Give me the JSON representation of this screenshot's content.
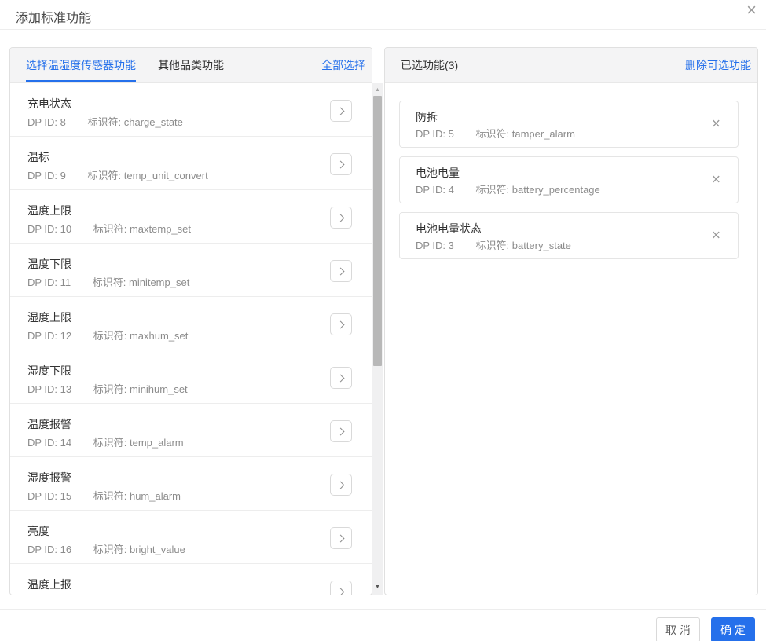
{
  "dialog": {
    "title": "添加标准功能"
  },
  "colors": {
    "accent": "#2570eb",
    "header_bg": "#f4f4f5",
    "panel_border": "#e0e0e0",
    "meta_text": "#8c8c8c"
  },
  "icons": {
    "close": "×",
    "remove": "×",
    "chevron_right": ">",
    "scroll_up": "▲",
    "scroll_down": "▼"
  },
  "left_panel": {
    "tabs": [
      {
        "label": "选择温湿度传感器功能",
        "active": true
      },
      {
        "label": "其他品类功能",
        "active": false
      }
    ],
    "select_all_label": "全部选择",
    "items": [
      {
        "name": "充电状态",
        "dp": "DP ID: 8",
        "identifier": "标识符: charge_state"
      },
      {
        "name": "温标",
        "dp": "DP ID: 9",
        "identifier": "标识符: temp_unit_convert"
      },
      {
        "name": "温度上限",
        "dp": "DP ID: 10",
        "identifier": "标识符: maxtemp_set"
      },
      {
        "name": "温度下限",
        "dp": "DP ID: 11",
        "identifier": "标识符: minitemp_set"
      },
      {
        "name": "湿度上限",
        "dp": "DP ID: 12",
        "identifier": "标识符: maxhum_set"
      },
      {
        "name": "湿度下限",
        "dp": "DP ID: 13",
        "identifier": "标识符: minihum_set"
      },
      {
        "name": "温度报警",
        "dp": "DP ID: 14",
        "identifier": "标识符: temp_alarm"
      },
      {
        "name": "湿度报警",
        "dp": "DP ID: 15",
        "identifier": "标识符: hum_alarm"
      },
      {
        "name": "亮度",
        "dp": "DP ID: 16",
        "identifier": "标识符: bright_value"
      },
      {
        "name": "温度上报",
        "dp": "",
        "identifier": ""
      }
    ]
  },
  "right_panel": {
    "title": "已选功能(3)",
    "delete_label": "删除可选功能",
    "items": [
      {
        "name": "防拆",
        "dp": "DP ID: 5",
        "identifier": "标识符: tamper_alarm"
      },
      {
        "name": "电池电量",
        "dp": "DP ID: 4",
        "identifier": "标识符: battery_percentage"
      },
      {
        "name": "电池电量状态",
        "dp": "DP ID: 3",
        "identifier": "标识符: battery_state"
      }
    ]
  },
  "footer": {
    "cancel_label": "取 消",
    "confirm_label": "确 定"
  }
}
